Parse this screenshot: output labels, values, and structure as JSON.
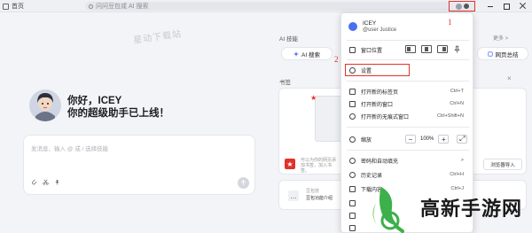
{
  "titlebar": {
    "home_tab": "首页",
    "address_placeholder": "问问豆包或 AI 搜索"
  },
  "left": {
    "watermark": "星动下载站",
    "greeting_line1": "你好，ICEY",
    "greeting_line2": "你的超级助手已上线！",
    "chat_placeholder": "发消息、输入 @ 或 / 选择技能"
  },
  "right": {
    "ai_skills_title": "AI 技能",
    "more_label": "更多 >",
    "ai_search": "AI 搜索",
    "web_summary": "网页总结",
    "bookmarks_title": "书签",
    "bookmark_hint": "可以为你的网页添加书签，加入书签。",
    "import_btn": "浏览器导入",
    "doubao_line1": "豆包技",
    "doubao_line2": "豆包功能介绍"
  },
  "menu": {
    "user_name": "ICEY",
    "user_handle": "@user Justice",
    "window_position": "窗口位置",
    "settings": "设置",
    "items": [
      {
        "label": "打开新的标签页",
        "shortcut": "Ctrl+T"
      },
      {
        "label": "打开新的窗口",
        "shortcut": "Ctrl+N"
      },
      {
        "label": "打开新的无痕式窗口",
        "shortcut": "Ctrl+Shift+N"
      }
    ],
    "zoom_label": "缩放",
    "zoom_value": "100%",
    "items2": [
      {
        "label": "密码和自动填充",
        "shortcut": ">"
      },
      {
        "label": "历史记录",
        "shortcut": "Ctrl+H"
      },
      {
        "label": "下载内容",
        "shortcut": "Ctrl+J"
      }
    ]
  },
  "annotations": {
    "one": "1",
    "two": "2"
  },
  "brand": {
    "text": "高新手游网"
  },
  "colors": {
    "accent_red": "#e2322b",
    "brand_green": "#3cb04a"
  }
}
